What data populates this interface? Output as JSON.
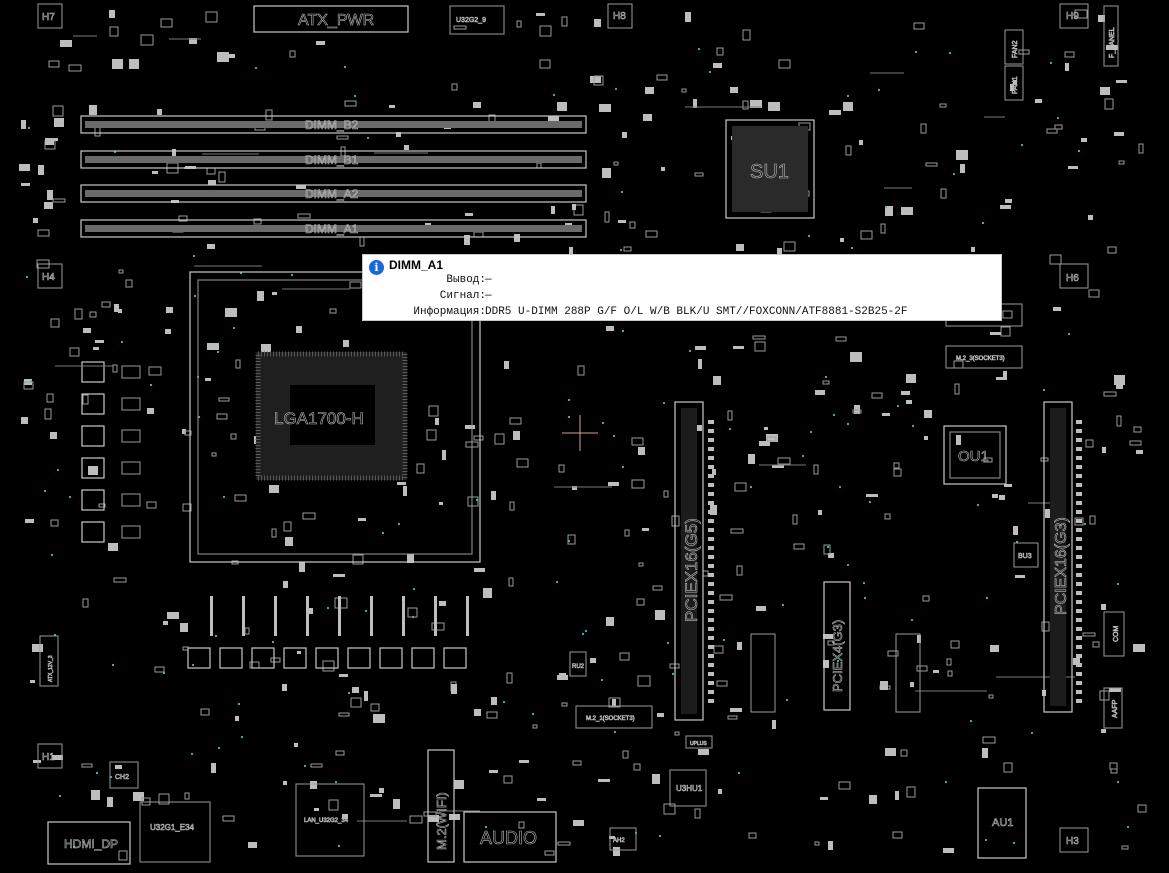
{
  "board_labels": {
    "atx_pwr": "ATX_PWR",
    "u32g2": "U32G2_9",
    "dimm_b2": "DIMM_B2",
    "dimm_b1": "DIMM_B1",
    "dimm_a2": "DIMM_A2",
    "dimm_a1": "DIMM_A1",
    "su1": "SU1",
    "cpu_socket": "LGA1700-H",
    "ou1": "OU1",
    "pciex16_g5": "PCIEX16(G5)",
    "pciex16_g3": "PCIEX16(G3)",
    "pciex4_g3": "PCIEX4(G3)",
    "m2_3": "M.2_3(SOCKET3)",
    "m2_1": "M.2_1(SOCKET3)",
    "m2_wifi": "M.2(WIFI)",
    "audio": "AUDIO",
    "hdmi_dp": "HDMI_DP",
    "u32g1": "U32G1_E34",
    "lan": "LAN_U32G2_34",
    "au1": "AU1",
    "u3hu1": "U3HU1",
    "bu3": "BU3",
    "panel": "F_PANEL",
    "atx12v": "ATX_12V_3",
    "h1": "H1",
    "h3": "H3",
    "h4": "H4",
    "h6": "H6",
    "h7": "H7",
    "h8": "H8",
    "h9": "H9",
    "com": "COM",
    "aafp": "AAFP",
    "fan1": "FAN1",
    "fan2": "FAN2",
    "ru2": "RU2",
    "ch2": "CH2",
    "uplus": "UPLUS",
    "ah2": "AH2"
  },
  "tooltip": {
    "icon": "info-icon",
    "title": "DIMM_A1",
    "rows": [
      {
        "key": "Вывод:",
        "value": "—"
      },
      {
        "key": "Сигнал:",
        "value": "—"
      },
      {
        "key": "Информация:",
        "value": "DDR5 U-DIMM 288P G/F O/L W/B BLK/U SMT//FOXCONN/ATF8881-S2B25-2F"
      }
    ]
  },
  "colors": {
    "background": "#000000",
    "outline": "#9a9a9a",
    "via": "#2fc7c7",
    "crosshair": "#d8a0a0",
    "tooltip_bg": "#ffffff",
    "info_icon": "#1769d6"
  }
}
